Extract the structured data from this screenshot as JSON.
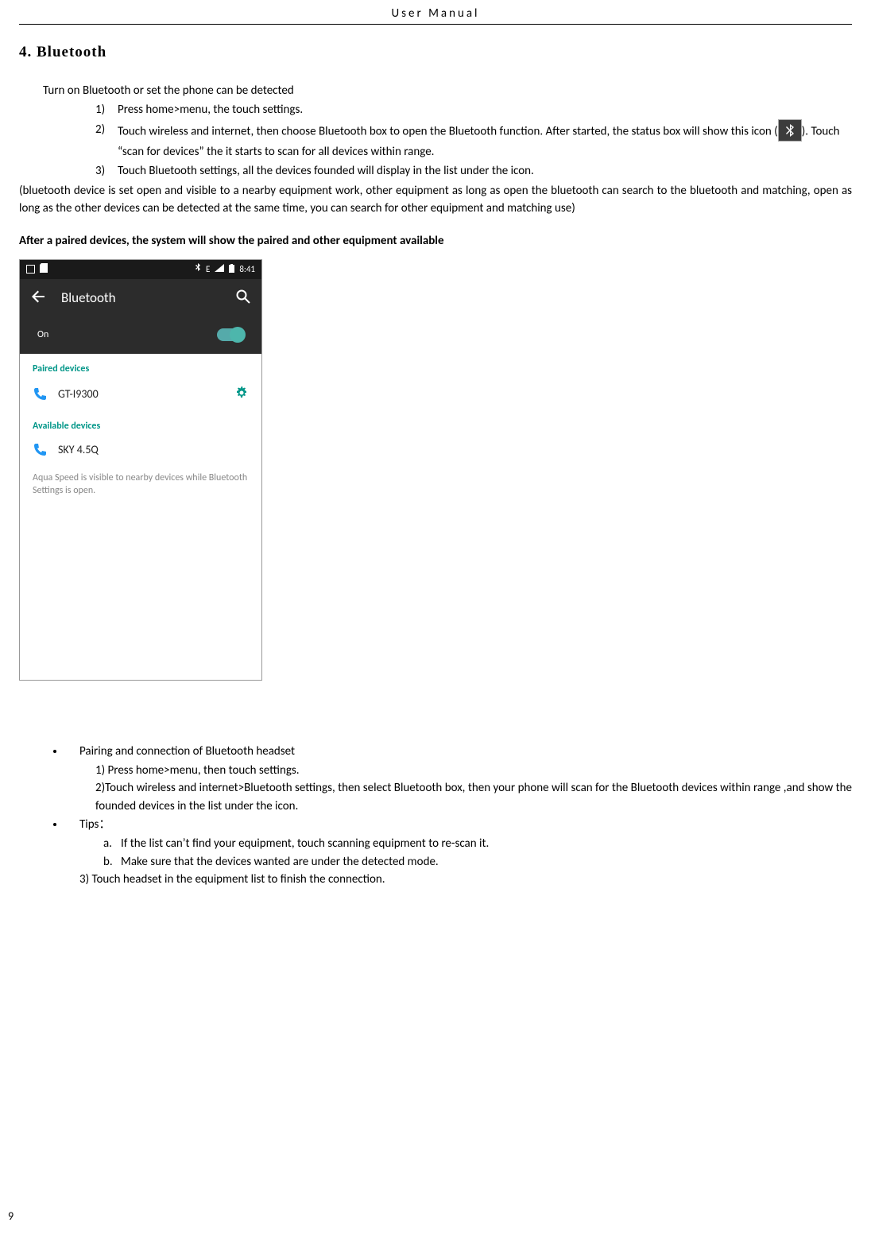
{
  "header": {
    "title": "User  Manual"
  },
  "section": {
    "title": "4. Bluetooth"
  },
  "intro": "Turn on Bluetooth or set the phone can be detected",
  "steps": [
    {
      "num": "1)",
      "text": "Press home>menu, the touch settings."
    },
    {
      "num": "2)",
      "text_pre": "Touch wireless and internet, then choose Bluetooth box to open the Bluetooth function. After started, the status box will show this icon (",
      "text_post": "). Touch  “scan for devices” the it starts to scan for all devices within range."
    },
    {
      "num": "3)",
      "text": "Touch Bluetooth settings, all the devices founded will display in the list under the icon."
    }
  ],
  "note_paren": "(bluetooth device is set open and visible to a nearby equipment work, other equipment as long as open the bluetooth can search to the bluetooth and matching, open as long as the other devices can be detected at the same time, you can search for other equipment and matching use)",
  "bold_line": "After a paired devices, the system will show the paired and other equipment available",
  "phone": {
    "status": {
      "edge": "E",
      "time": "8:41"
    },
    "appbar_title": "Bluetooth",
    "on_label": "On",
    "paired_header": "Paired devices",
    "paired_device": "GT-I9300",
    "avail_header": "Available devices",
    "avail_device": "SKY 4.5Q",
    "visibility": "Aqua Speed is visible to nearby devices while Bluetooth Settings is open."
  },
  "pairing": {
    "title": "Pairing and connection of Bluetooth headset",
    "step1": "1) Press home>menu, then touch settings.",
    "step2": "2)Touch wireless and internet>Bluetooth settings, then select Bluetooth box, then your phone will scan for the Bluetooth devices within range ,and show the founded devices in the list under the icon."
  },
  "tips": {
    "title": "Tips：",
    "a": "If the list can’t find your equipment, touch scanning equipment to re-scan it.",
    "b": "Make sure that the devices wanted are under the detected mode.",
    "step3": "3) Touch headset in the equipment list to finish the connection."
  },
  "page_number": "9"
}
